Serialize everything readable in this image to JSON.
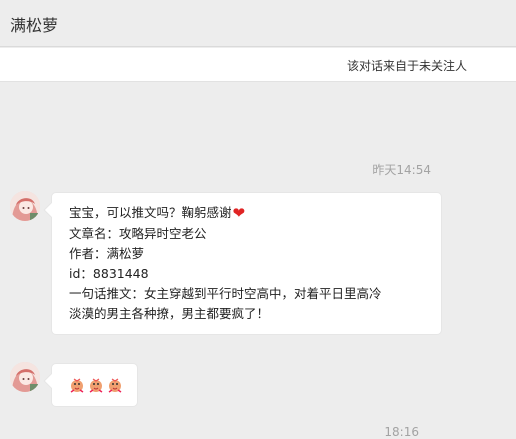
{
  "header": {
    "title": "满松萝"
  },
  "notice": {
    "text": "该对话来自于未关注人"
  },
  "messages": [
    {
      "timestamp": "昨天14:54",
      "lines": [
        "宝宝，可以推文吗？鞠躬感谢",
        "文章名：攻略异时空老公",
        "作者：满松萝",
        "id：8831448",
        "一句话推文：女主穿越到平行时空高中，对着平日里高冷",
        "淡漠的男主各种撩，男主都要疯了！"
      ],
      "emoji": "❤"
    },
    {
      "stickers": [
        "chick-sticker",
        "chick-sticker",
        "chick-sticker"
      ]
    }
  ],
  "bottom_timestamp": "18:16",
  "colors": {
    "accent_heart": "#e02424",
    "bubble": "#ffffff",
    "background": "#ededed"
  }
}
